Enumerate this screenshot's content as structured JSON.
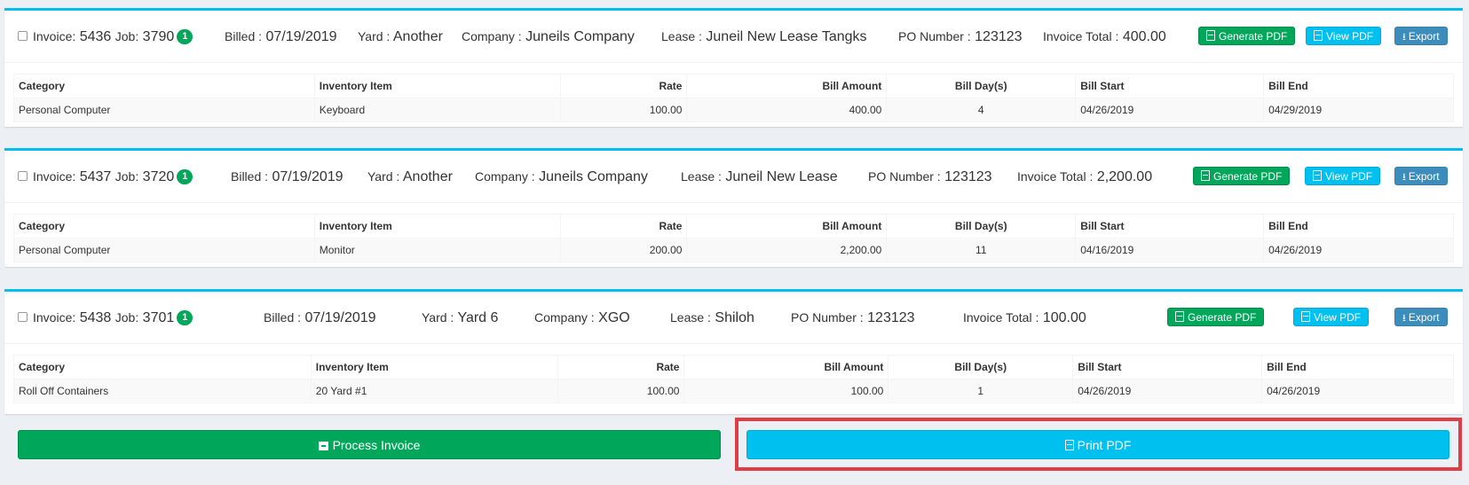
{
  "colors": {
    "green": "#00a65a",
    "info": "#00c0ef",
    "blue": "#3c8dbc",
    "highlight": "#e03c46"
  },
  "labels": {
    "invoice": "Invoice:",
    "job": "Job:",
    "billed": "Billed :",
    "yard": "Yard :",
    "company": "Company :",
    "lease": "Lease :",
    "po_number": "PO Number :",
    "invoice_total": "Invoice Total :",
    "generate_pdf": "Generate PDF",
    "view_pdf": "View PDF",
    "export": "Export"
  },
  "columns": [
    "Category",
    "Inventory Item",
    "Rate",
    "Bill Amount",
    "Bill Day(s)",
    "Bill Start",
    "Bill End"
  ],
  "invoices": [
    {
      "invoice_no": "5436",
      "job_no": "3790",
      "badge": "1",
      "billed": "07/19/2019",
      "yard": "Another",
      "company": "Juneils Company",
      "lease": "Juneil New Lease Tangks",
      "po_number": "123123",
      "total": "400.00",
      "row": [
        "Personal Computer",
        "Keyboard",
        "100.00",
        "400.00",
        "4",
        "04/26/2019",
        "04/29/2019"
      ]
    },
    {
      "invoice_no": "5437",
      "job_no": "3720",
      "badge": "1",
      "billed": "07/19/2019",
      "yard": "Another",
      "company": "Juneils Company",
      "lease": "Juneil New Lease",
      "po_number": "123123",
      "total": "2,200.00",
      "row": [
        "Personal Computer",
        "Monitor",
        "200.00",
        "2,200.00",
        "11",
        "04/16/2019",
        "04/26/2019"
      ]
    },
    {
      "invoice_no": "5438",
      "job_no": "3701",
      "badge": "1",
      "billed": "07/19/2019",
      "yard": "Yard 6",
      "company": "XGO",
      "lease": "Shiloh",
      "po_number": "123123",
      "total": "100.00",
      "row": [
        "Roll Off Containers",
        "20 Yard #1",
        "100.00",
        "100.00",
        "1",
        "04/26/2019",
        "04/26/2019"
      ]
    }
  ],
  "actions": {
    "process": "Process Invoice",
    "print": "Print PDF"
  }
}
